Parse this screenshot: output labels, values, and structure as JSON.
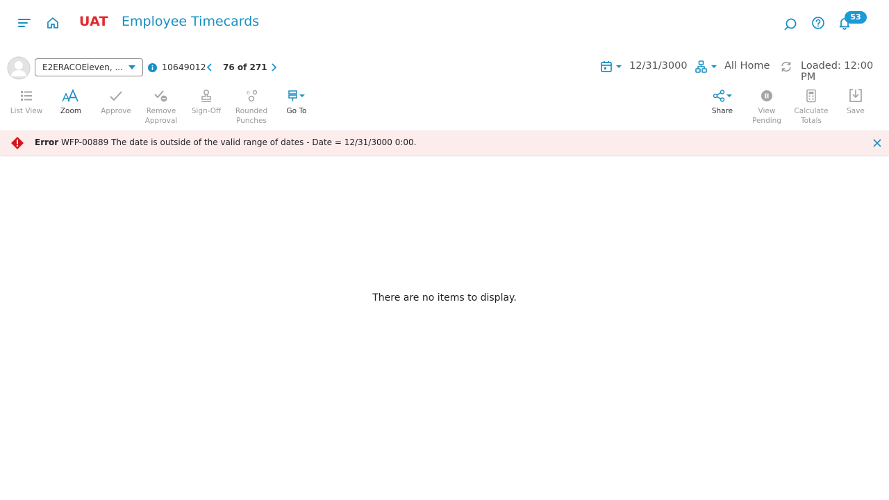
{
  "header": {
    "environment": "UAT",
    "title": "Employee Timecards",
    "notifications_count": "53"
  },
  "employee_bar": {
    "selected_employee": "E2ERACOEleven, ...",
    "employee_id": "10649012",
    "pager": "76 of 271",
    "date": "12/31/3000",
    "location": "All Home",
    "loaded": "Loaded: 12:00 PM"
  },
  "toolbar": {
    "left": [
      {
        "label_lines": [
          "List View"
        ],
        "icon": "list-icon",
        "enabled": false
      },
      {
        "label_lines": [
          "Zoom"
        ],
        "icon": "zoom-text-icon",
        "enabled": true
      },
      {
        "label_lines": [
          "Approve"
        ],
        "icon": "check-icon",
        "enabled": false
      },
      {
        "label_lines": [
          "Remove",
          "Approval"
        ],
        "icon": "remove-approval-icon",
        "enabled": false
      },
      {
        "label_lines": [
          "Sign-Off"
        ],
        "icon": "stamp-icon",
        "enabled": false
      },
      {
        "label_lines": [
          "Rounded",
          "Punches"
        ],
        "icon": "rounded-punches-icon",
        "enabled": false
      },
      {
        "label_lines": [
          "Go To"
        ],
        "icon": "signpost-icon",
        "enabled": true
      }
    ],
    "right": [
      {
        "label_lines": [
          "Share"
        ],
        "icon": "share-icon",
        "enabled": true
      },
      {
        "label_lines": [
          "View",
          "Pending"
        ],
        "icon": "pending-icon",
        "enabled": false
      },
      {
        "label_lines": [
          "Calculate",
          "Totals"
        ],
        "icon": "calculator-icon",
        "enabled": false
      },
      {
        "label_lines": [
          "Save"
        ],
        "icon": "save-icon",
        "enabled": false
      }
    ]
  },
  "error": {
    "label": "Error",
    "message": "WFP-00889 The date is outside of the valid range of dates - Date = 12/31/3000 0:00."
  },
  "content": {
    "empty_message": "There are no items to display."
  },
  "colors": {
    "brand_blue": "#1a8fc4",
    "env_red": "#e6272e",
    "error_bg": "#fcecec",
    "error_icon": "#d7141d",
    "disabled": "#999999"
  }
}
